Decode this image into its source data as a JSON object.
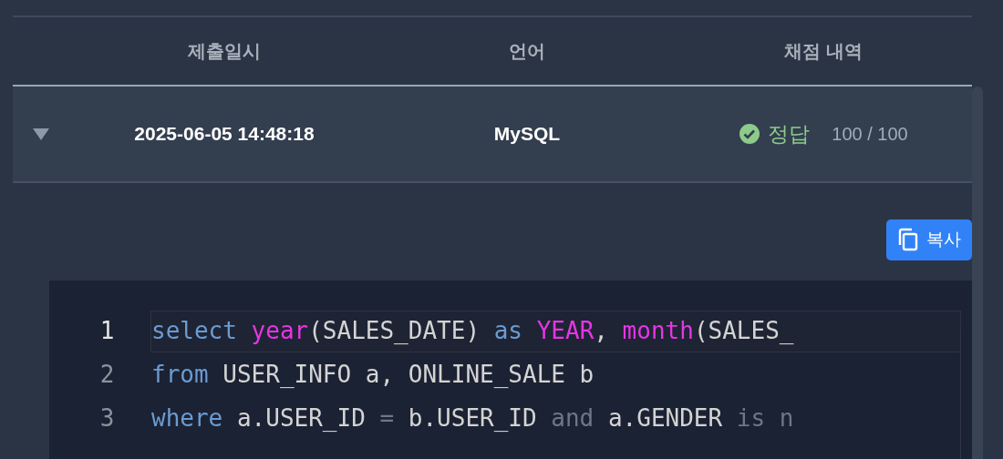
{
  "table": {
    "columns": [
      "제출일시",
      "언어",
      "채점 내역"
    ],
    "rows": [
      {
        "expanded": true,
        "submitted_at": "2025-06-05 14:48:18",
        "language": "MySQL",
        "result": {
          "kind": "correct",
          "label": "정답",
          "score": "100 / 100"
        }
      }
    ]
  },
  "copy_button": {
    "label": "복사"
  },
  "code": {
    "lines": [
      {
        "number": "1",
        "current": true,
        "tokens": [
          {
            "kind": "keyword",
            "text": "select "
          },
          {
            "kind": "function",
            "text": "year"
          },
          {
            "kind": "plain",
            "text": "(SALES_DATE) "
          },
          {
            "kind": "keyword",
            "text": "as "
          },
          {
            "kind": "function",
            "text": "YEAR"
          },
          {
            "kind": "plain",
            "text": ", "
          },
          {
            "kind": "function",
            "text": "month"
          },
          {
            "kind": "plain",
            "text": "(SALES_"
          }
        ]
      },
      {
        "number": "2",
        "current": false,
        "tokens": [
          {
            "kind": "keyword",
            "text": "from"
          },
          {
            "kind": "plain",
            "text": " USER_INFO a, ONLINE_SALE b"
          }
        ]
      },
      {
        "number": "3",
        "current": false,
        "tokens": [
          {
            "kind": "keyword",
            "text": "where"
          },
          {
            "kind": "plain",
            "text": " a.USER_ID "
          },
          {
            "kind": "operator",
            "text": "="
          },
          {
            "kind": "plain",
            "text": " b.USER_ID "
          },
          {
            "kind": "operator",
            "text": "and"
          },
          {
            "kind": "plain",
            "text": " a.GENDER "
          },
          {
            "kind": "operator",
            "text": "is n"
          }
        ]
      }
    ]
  }
}
